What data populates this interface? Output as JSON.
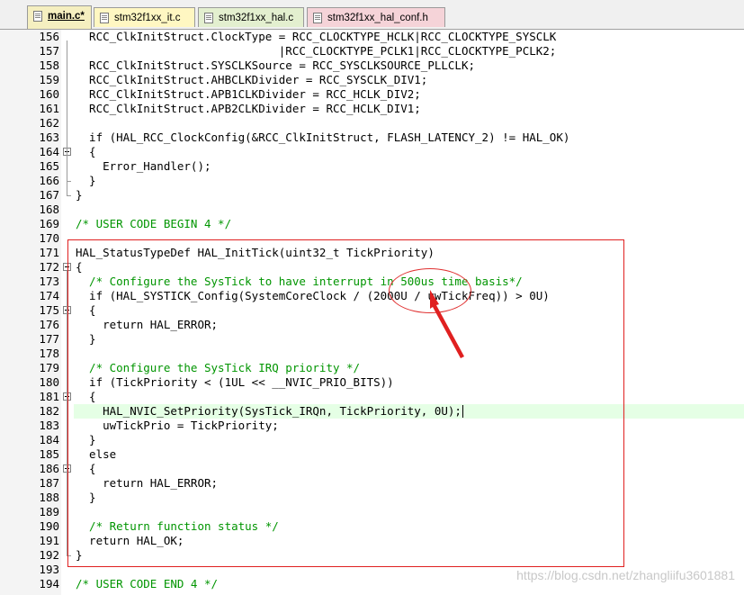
{
  "tabs": [
    {
      "label": "main.c*",
      "active": true,
      "color": "#f5efc0"
    },
    {
      "label": "stm32f1xx_it.c",
      "active": false,
      "color": "#fff7c2"
    },
    {
      "label": "stm32f1xx_hal.c",
      "active": false,
      "color": "#e3efcf"
    },
    {
      "label": "stm32f1xx_hal_conf.h",
      "active": false,
      "color": "#f5d3d8"
    }
  ],
  "lines": [
    {
      "n": "156",
      "text": "  RCC_ClkInitStruct.ClockType = RCC_CLOCKTYPE_HCLK|RCC_CLOCKTYPE_SYSCLK",
      "kind": "code"
    },
    {
      "n": "157",
      "text": "                              |RCC_CLOCKTYPE_PCLK1|RCC_CLOCKTYPE_PCLK2;",
      "kind": "code"
    },
    {
      "n": "158",
      "text": "  RCC_ClkInitStruct.SYSCLKSource = RCC_SYSCLKSOURCE_PLLCLK;",
      "kind": "code"
    },
    {
      "n": "159",
      "text": "  RCC_ClkInitStruct.AHBCLKDivider = RCC_SYSCLK_DIV1;",
      "kind": "code"
    },
    {
      "n": "160",
      "text": "  RCC_ClkInitStruct.APB1CLKDivider = RCC_HCLK_DIV2;",
      "kind": "code"
    },
    {
      "n": "161",
      "text": "  RCC_ClkInitStruct.APB2CLKDivider = RCC_HCLK_DIV1;",
      "kind": "code"
    },
    {
      "n": "162",
      "text": "",
      "kind": "code"
    },
    {
      "n": "163",
      "text": "  if (HAL_RCC_ClockConfig(&RCC_ClkInitStruct, FLASH_LATENCY_2) != HAL_OK)",
      "kind": "code"
    },
    {
      "n": "164",
      "text": "  {",
      "kind": "code",
      "fold": true
    },
    {
      "n": "165",
      "text": "    Error_Handler();",
      "kind": "code"
    },
    {
      "n": "166",
      "text": "  }",
      "kind": "code"
    },
    {
      "n": "167",
      "text": "}",
      "kind": "code"
    },
    {
      "n": "168",
      "text": "",
      "kind": "code"
    },
    {
      "n": "169",
      "text": "/* USER CODE BEGIN 4 */",
      "kind": "comment"
    },
    {
      "n": "170",
      "text": "",
      "kind": "code"
    },
    {
      "n": "171",
      "text": "HAL_StatusTypeDef HAL_InitTick(uint32_t TickPriority)",
      "kind": "code"
    },
    {
      "n": "172",
      "text": "{",
      "kind": "code",
      "fold": true
    },
    {
      "n": "173",
      "text": "  /* Configure the SysTick to have interrupt in 500us time basis*/",
      "kind": "comment"
    },
    {
      "n": "174",
      "text": "  if (HAL_SYSTICK_Config(SystemCoreClock / (2000U / uwTickFreq)) > 0U)",
      "kind": "code"
    },
    {
      "n": "175",
      "text": "  {",
      "kind": "code",
      "fold": true
    },
    {
      "n": "176",
      "text": "    return HAL_ERROR;",
      "kind": "code"
    },
    {
      "n": "177",
      "text": "  }",
      "kind": "code"
    },
    {
      "n": "178",
      "text": "",
      "kind": "code"
    },
    {
      "n": "179",
      "text": "  /* Configure the SysTick IRQ priority */",
      "kind": "comment"
    },
    {
      "n": "180",
      "text": "  if (TickPriority < (1UL << __NVIC_PRIO_BITS))",
      "kind": "code"
    },
    {
      "n": "181",
      "text": "  {",
      "kind": "code",
      "fold": true
    },
    {
      "n": "182",
      "text": "    HAL_NVIC_SetPriority(SysTick_IRQn, TickPriority, 0U);",
      "kind": "code",
      "highlight": true
    },
    {
      "n": "183",
      "text": "    uwTickPrio = TickPriority;",
      "kind": "code"
    },
    {
      "n": "184",
      "text": "  }",
      "kind": "code"
    },
    {
      "n": "185",
      "text": "  else",
      "kind": "code"
    },
    {
      "n": "186",
      "text": "  {",
      "kind": "code",
      "fold": true
    },
    {
      "n": "187",
      "text": "    return HAL_ERROR;",
      "kind": "code"
    },
    {
      "n": "188",
      "text": "  }",
      "kind": "code"
    },
    {
      "n": "189",
      "text": "",
      "kind": "code"
    },
    {
      "n": "190",
      "text": "  /* Return function status */",
      "kind": "comment"
    },
    {
      "n": "191",
      "text": "  return HAL_OK;",
      "kind": "code"
    },
    {
      "n": "192",
      "text": "}",
      "kind": "code"
    },
    {
      "n": "193",
      "text": "",
      "kind": "code"
    },
    {
      "n": "194",
      "text": "/* USER CODE END 4 */",
      "kind": "comment"
    }
  ],
  "watermark": "https://blog.csdn.net/zhangliifu3601881",
  "colors": {
    "comment": "#009500",
    "annotation": "#e02020",
    "current_line": "#e5ffe5"
  }
}
